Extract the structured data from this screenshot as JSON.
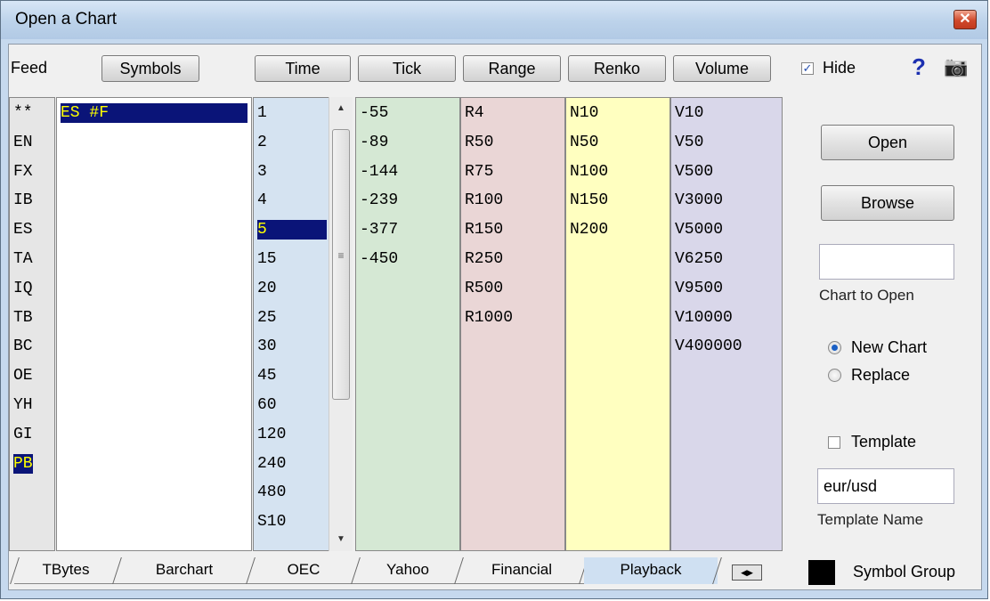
{
  "window": {
    "title": "Open a Chart",
    "close_glyph": "✕"
  },
  "toolbar": {
    "feed_label": "Feed",
    "symbols_label": "Symbols",
    "time_label": "Time",
    "tick_label": "Tick",
    "range_label": "Range",
    "renko_label": "Renko",
    "volume_label": "Volume",
    "hide_label": "Hide",
    "hide_checked": true,
    "help_glyph": "?",
    "camera_glyph": "📷"
  },
  "feeds": [
    "**",
    "EN",
    "FX",
    "IB",
    "ES",
    "TA",
    "IQ",
    "TB",
    "BC",
    "OE",
    "YH",
    "GI",
    "PB"
  ],
  "feeds_selected": "PB",
  "symbols": [
    "ES #F"
  ],
  "time": [
    "1",
    "2",
    "3",
    "4",
    "5",
    "15",
    "20",
    "25",
    "30",
    "45",
    "60",
    "120",
    "240",
    "480",
    "S10"
  ],
  "time_selected": "5",
  "tick": [
    "-55",
    "-89",
    "-144",
    "-239",
    "-377",
    "-450"
  ],
  "range": [
    "R4",
    "R50",
    "R75",
    "R100",
    "R150",
    "R250",
    "R500",
    "R1000"
  ],
  "renko": [
    "N10",
    "N50",
    "N100",
    "N150",
    "N200"
  ],
  "volume": [
    "V10",
    "V50",
    "V500",
    "V3000",
    "V5000",
    "V6250",
    "V9500",
    "V10000",
    "V400000"
  ],
  "right": {
    "open_label": "Open",
    "browse_label": "Browse",
    "chart_to_open_value": "",
    "chart_to_open_label": "Chart to Open",
    "new_chart_label": "New Chart",
    "replace_label": "Replace",
    "chart_mode": "New Chart",
    "template_label": "Template",
    "template_checked": false,
    "template_name_value": "eur/usd",
    "template_name_label": "Template Name",
    "symbol_group_label": "Symbol Group",
    "symbol_group_color": "#000000"
  },
  "tabs": [
    "TBytes",
    "Barchart",
    "OEC",
    "Yahoo",
    "Financial",
    "Playback"
  ],
  "active_tab": "Playback",
  "tab_nav_glyph": "◀▶",
  "colors": {
    "time_bg": "#d5e3f1",
    "tick_bg": "#d5e8d4",
    "range_bg": "#ead6d6",
    "renko_bg": "#ffffc0",
    "volume_bg": "#d9d7ea",
    "selection": "#0a1478"
  }
}
